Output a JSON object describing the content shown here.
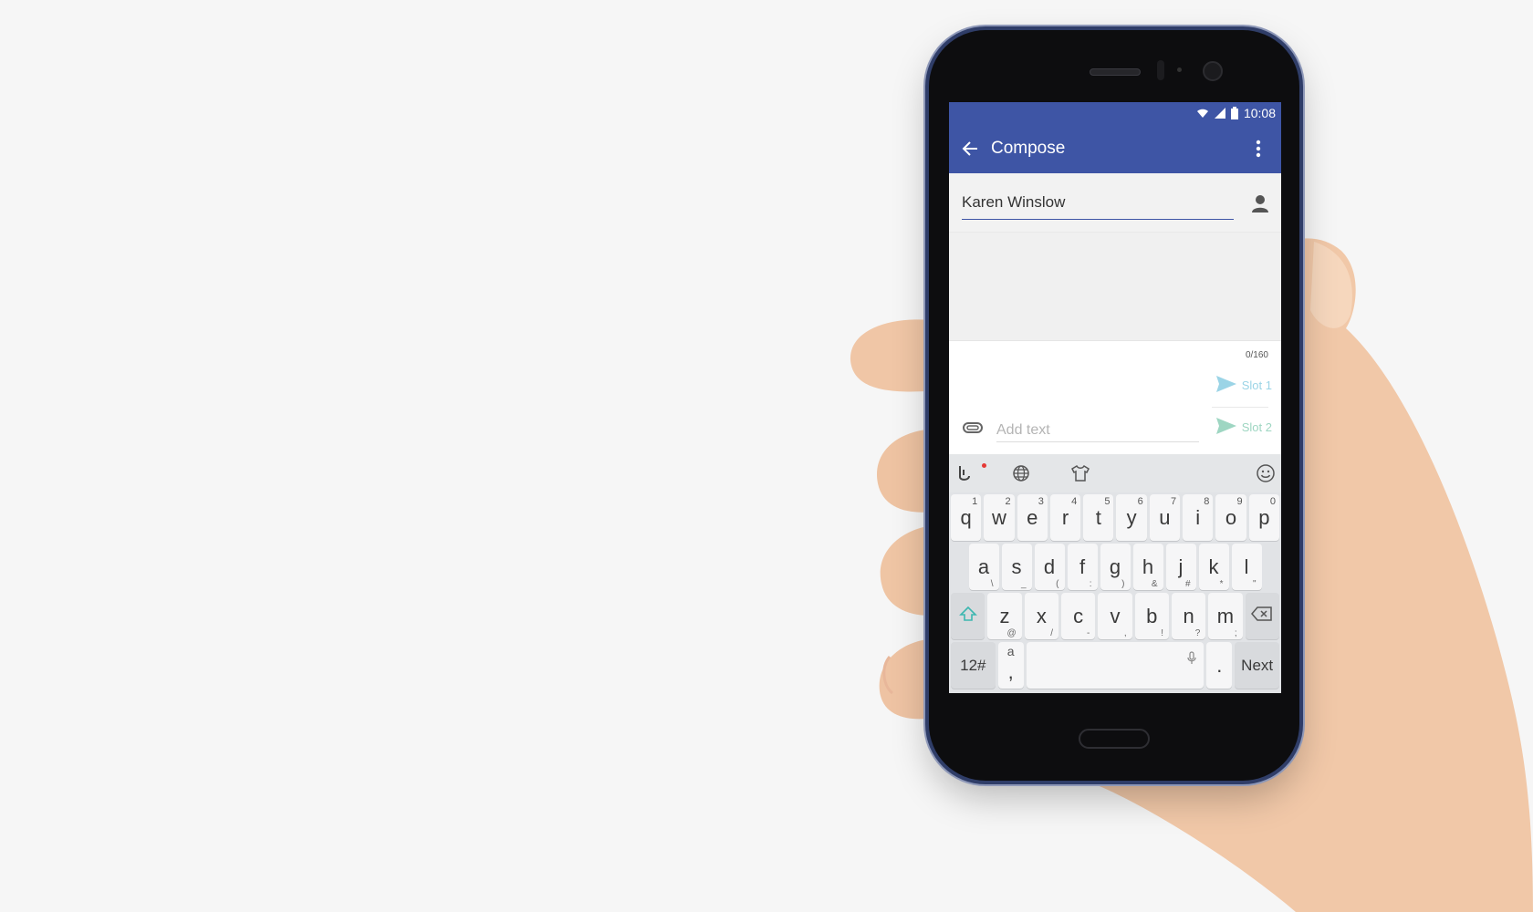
{
  "status_bar": {
    "time": "10:08"
  },
  "toolbar": {
    "title": "Compose"
  },
  "recipient": {
    "value": "Karen Winslow"
  },
  "compose": {
    "counter": "0/160",
    "placeholder": "Add text",
    "slot1_label": "Slot 1",
    "slot2_label": "Slot 2"
  },
  "keyboard": {
    "row1": [
      {
        "k": "q",
        "h": "1"
      },
      {
        "k": "w",
        "h": "2"
      },
      {
        "k": "e",
        "h": "3"
      },
      {
        "k": "r",
        "h": "4"
      },
      {
        "k": "t",
        "h": "5"
      },
      {
        "k": "y",
        "h": "6"
      },
      {
        "k": "u",
        "h": "7"
      },
      {
        "k": "i",
        "h": "8"
      },
      {
        "k": "o",
        "h": "9"
      },
      {
        "k": "p",
        "h": "0"
      }
    ],
    "row2": [
      {
        "k": "a",
        "s": "\\"
      },
      {
        "k": "s",
        "s": "_"
      },
      {
        "k": "d",
        "s": "("
      },
      {
        "k": "f",
        "s": ":"
      },
      {
        "k": "g",
        "s": ")"
      },
      {
        "k": "h",
        "s": "&"
      },
      {
        "k": "j",
        "s": "#"
      },
      {
        "k": "k",
        "s": "*"
      },
      {
        "k": "l",
        "s": "\""
      }
    ],
    "row3": [
      {
        "k": "z",
        "s": "@"
      },
      {
        "k": "x",
        "s": "/"
      },
      {
        "k": "c",
        "s": "-"
      },
      {
        "k": "v",
        "s": ","
      },
      {
        "k": "b",
        "s": "!"
      },
      {
        "k": "n",
        "s": "?"
      },
      {
        "k": "m",
        "s": ";"
      }
    ],
    "symbols_label": "12#",
    "comma_top": "a",
    "comma": ",",
    "period": ".",
    "next_label": "Next"
  },
  "colors": {
    "accent": "#3e55a5",
    "slot1": "#9bd4e6",
    "slot2": "#9ed6c2"
  },
  "icons": [
    "wifi-icon",
    "signal-icon",
    "battery-icon",
    "back-arrow-icon",
    "more-vert-icon",
    "person-icon",
    "send-icon",
    "attach-icon",
    "handwriting-icon",
    "globe-icon",
    "theme-shirt-icon",
    "emoji-icon",
    "shift-icon",
    "backspace-icon",
    "mic-icon"
  ]
}
